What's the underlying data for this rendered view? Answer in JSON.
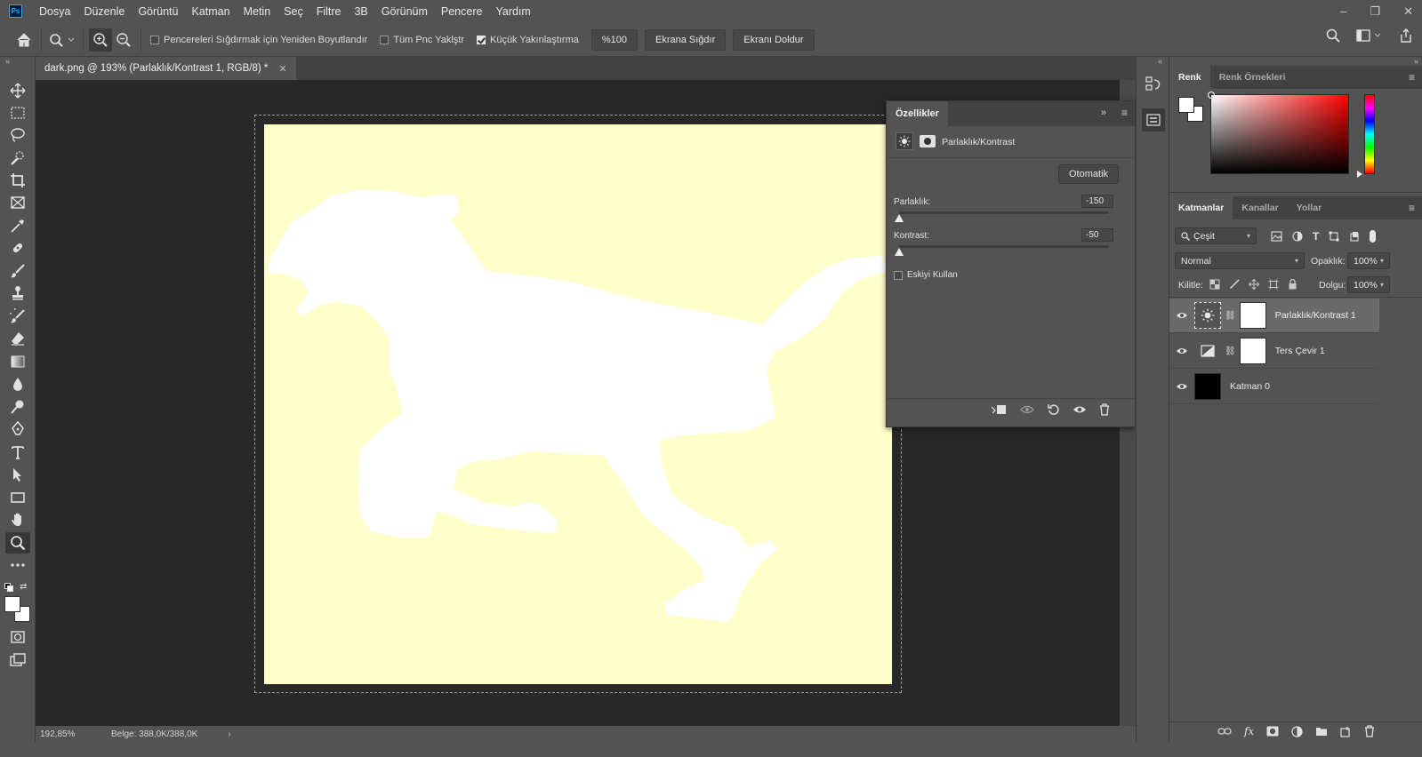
{
  "app": {
    "logo": "Ps"
  },
  "menu": [
    "Dosya",
    "Düzenle",
    "Görüntü",
    "Katman",
    "Metin",
    "Seç",
    "Filtre",
    "3B",
    "Görünüm",
    "Pencere",
    "Yardım"
  ],
  "options": {
    "resize_windows": "Pencereleri Sığdırmak için Yeniden Boyutlandır",
    "zoom_all": "Tüm Pnc Yaklştr",
    "scrubby_zoom": "Küçük Yakınlaştırma",
    "zoom_100": "%100",
    "fit_screen": "Ekrana Sığdır",
    "fill_screen": "Ekranı Doldur"
  },
  "document": {
    "tab_title": "dark.png @ 193% (Parlaklık/Kontrast 1, RGB/8) *",
    "canvas_color": "#ffffca",
    "silhouette_color": "#ffffff"
  },
  "status": {
    "zoom": "192,85%",
    "doc": "Belge: 388,0K/388,0K"
  },
  "properties": {
    "title": "Özellikler",
    "adjustment": "Parlaklık/Kontrast",
    "auto_btn": "Otomatik",
    "brightness_label": "Parlaklık:",
    "brightness_value": "-150",
    "contrast_label": "Kontrast:",
    "contrast_value": "-50",
    "legacy_label": "Eskiyi Kullan"
  },
  "color_panel": {
    "tabs": [
      "Renk",
      "Renk Örnekleri"
    ]
  },
  "layers_panel": {
    "tabs": [
      "Katmanlar",
      "Kanallar",
      "Yollar"
    ],
    "filter": "Çeşit",
    "blend_mode": "Normal",
    "opacity_label": "Opaklık:",
    "opacity_value": "100%",
    "lock_label": "Kilitle:",
    "fill_label": "Dolgu:",
    "fill_value": "100%",
    "layers": [
      {
        "name": "Parlaklık/Kontrast 1"
      },
      {
        "name": "Ters Çevir 1"
      },
      {
        "name": "Katman 0"
      }
    ]
  }
}
